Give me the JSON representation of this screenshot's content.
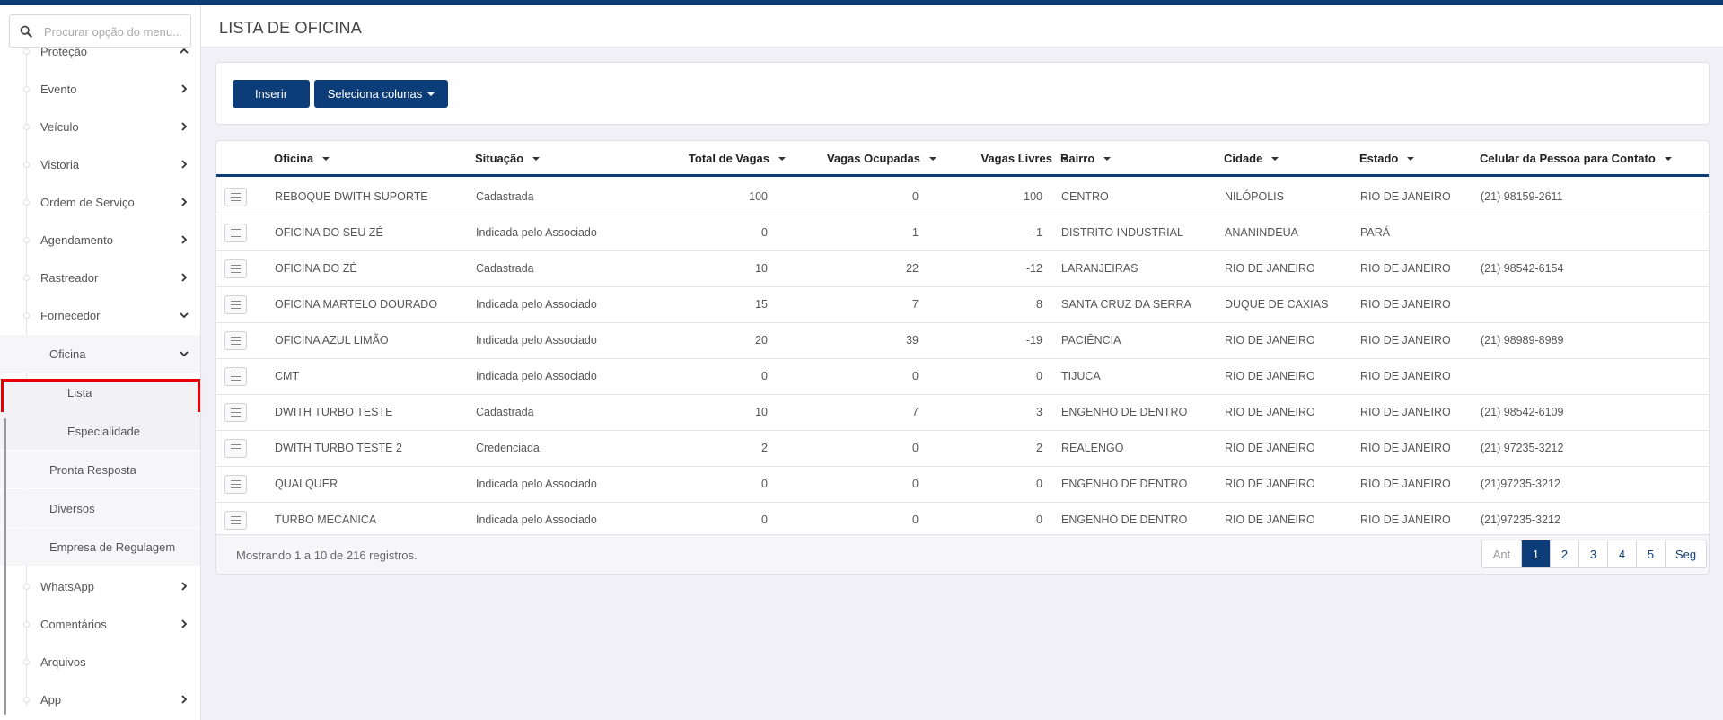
{
  "search": {
    "placeholder": "Procurar opção do menu..."
  },
  "sidebar": {
    "items": [
      {
        "label": "Proteção",
        "level": 1,
        "chevron": "up"
      },
      {
        "label": "Evento",
        "level": 1,
        "chevron": "right"
      },
      {
        "label": "Veículo",
        "level": 1,
        "chevron": "right"
      },
      {
        "label": "Vistoria",
        "level": 1,
        "chevron": "right"
      },
      {
        "label": "Ordem de Serviço",
        "level": 1,
        "chevron": "right"
      },
      {
        "label": "Agendamento",
        "level": 1,
        "chevron": "right"
      },
      {
        "label": "Rastreador",
        "level": 1,
        "chevron": "right"
      },
      {
        "label": "Fornecedor",
        "level": 1,
        "chevron": "down"
      },
      {
        "label": "Oficina",
        "level": 2,
        "chevron": "down"
      },
      {
        "label": "Lista",
        "level": 3,
        "chevron": ""
      },
      {
        "label": "Especialidade",
        "level": 3,
        "chevron": ""
      },
      {
        "label": "Pronta Resposta",
        "level": 2,
        "chevron": ""
      },
      {
        "label": "Diversos",
        "level": 2,
        "chevron": ""
      },
      {
        "label": "Empresa de Regulagem",
        "level": 2,
        "chevron": ""
      },
      {
        "label": "WhatsApp",
        "level": 1,
        "chevron": "right"
      },
      {
        "label": "Comentários",
        "level": 1,
        "chevron": "right"
      },
      {
        "label": "Arquivos",
        "level": 1,
        "chevron": ""
      },
      {
        "label": "App",
        "level": 1,
        "chevron": "right"
      }
    ]
  },
  "header": {
    "title": "LISTA DE OFICINA"
  },
  "toolbar": {
    "insert_label": "Inserir",
    "columns_label": "Seleciona colunas"
  },
  "table": {
    "columns": [
      "Oficina",
      "Situação",
      "Total de Vagas",
      "Vagas Ocupadas",
      "Vagas Livres",
      "Bairro",
      "Cidade",
      "Estado",
      "Celular da Pessoa para Contato"
    ],
    "rows": [
      [
        "REBOQUE DWITH SUPORTE",
        "Cadastrada",
        "100",
        "0",
        "100",
        "CENTRO",
        "NILÓPOLIS",
        "RIO DE JANEIRO",
        "(21) 98159-2611"
      ],
      [
        "OFICINA DO SEU ZÉ",
        "Indicada pelo Associado",
        "0",
        "1",
        "-1",
        "DISTRITO INDUSTRIAL",
        "ANANINDEUA",
        "PARÁ",
        ""
      ],
      [
        "OFICINA DO ZÉ",
        "Cadastrada",
        "10",
        "22",
        "-12",
        "LARANJEIRAS",
        "RIO DE JANEIRO",
        "RIO DE JANEIRO",
        "(21) 98542-6154"
      ],
      [
        "OFICINA MARTELO DOURADO",
        "Indicada pelo Associado",
        "15",
        "7",
        "8",
        "SANTA CRUZ DA SERRA",
        "DUQUE DE CAXIAS",
        "RIO DE JANEIRO",
        ""
      ],
      [
        "OFICINA AZUL LIMÃO",
        "Indicada pelo Associado",
        "20",
        "39",
        "-19",
        "PACIÊNCIA",
        "RIO DE JANEIRO",
        "RIO DE JANEIRO",
        "(21) 98989-8989"
      ],
      [
        "CMT",
        "Indicada pelo Associado",
        "0",
        "0",
        "0",
        "TIJUCA",
        "RIO DE JANEIRO",
        "RIO DE JANEIRO",
        ""
      ],
      [
        "DWITH TURBO TESTE",
        "Cadastrada",
        "10",
        "7",
        "3",
        "ENGENHO DE DENTRO",
        "RIO DE JANEIRO",
        "RIO DE JANEIRO",
        "(21) 98542-6109"
      ],
      [
        "DWITH TURBO TESTE 2",
        "Credenciada",
        "2",
        "0",
        "2",
        "REALENGO",
        "RIO DE JANEIRO",
        "RIO DE JANEIRO",
        "(21) 97235-3212"
      ],
      [
        "QUALQUER",
        "Indicada pelo Associado",
        "0",
        "0",
        "0",
        "ENGENHO DE DENTRO",
        "RIO DE JANEIRO",
        "RIO DE JANEIRO",
        "(21)97235-3212"
      ],
      [
        "TURBO MECANICA",
        "Indicada pelo Associado",
        "0",
        "0",
        "0",
        "ENGENHO DE DENTRO",
        "RIO DE JANEIRO",
        "RIO DE JANEIRO",
        "(21)97235-3212"
      ]
    ],
    "footer_info": "Mostrando 1 a 10 de 216 registros."
  },
  "pagination": {
    "prev_label": "Ant",
    "pages": [
      "1",
      "2",
      "3",
      "4",
      "5"
    ],
    "active": "1",
    "next_label": "Seg"
  },
  "colors": {
    "primary": "#0d3d78",
    "highlight": "#e60000"
  }
}
